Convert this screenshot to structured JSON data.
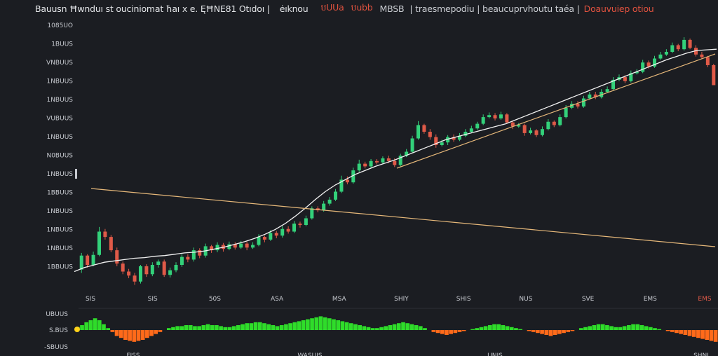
{
  "header": {
    "title": "Bauusn Ħwnduı st ouciniomat ħaı x e. ĘĦNE81 Otıdoı |",
    "segment_1": "ėıknou",
    "segment_2": "បUUa",
    "segment_3": "បubb",
    "segment_4": "MBSB",
    "segment_5": "| traesmepodiu | beaucuprvhoutu taéa |",
    "segment_6": "Doauvuiep otiou"
  },
  "price_axis": {
    "labels": [
      "1085UO",
      "1BUUS",
      "VNBUUS",
      "1NBUUS",
      "1NBUUS",
      "VUBUUS",
      "1NBUUS",
      "N0BUUS",
      "1NBUUS",
      "1BBUUS",
      "1NBUUS",
      "1NBUUS",
      "1NBUUS",
      "1BBUUS"
    ]
  },
  "time_axis": {
    "labels": [
      "SIS",
      "SIS",
      "50S",
      "ASA",
      "MSA",
      "SHIY",
      "SHIS",
      "NUS",
      "SVE",
      "EMS"
    ],
    "last_label": "EMS"
  },
  "oscillator": {
    "labels": [
      "UBUUS",
      "S.BUS",
      "-SBUUS"
    ],
    "bottom_labels": [
      "FISS",
      "WASUIS",
      "UNIS",
      "SHNI"
    ]
  },
  "colors": {
    "background": "#1b1d22",
    "up_candle": "#33d17a",
    "down_candle": "#e05a48",
    "moving_average": "#f2f2f2",
    "trendline": "#e6b87a",
    "histogram_positive": "#2fdc2a",
    "histogram_negative": "#ff6a1a",
    "highlight": "#ffd21a"
  },
  "chart_data": {
    "type": "candlestick",
    "series": [
      {
        "name": "",
        "values": [
          [
            0,
            367,
            346,
            372,
            342
          ],
          [
            1,
            346,
            360,
            364,
            344
          ],
          [
            2,
            360,
            345,
            362,
            340
          ],
          [
            3,
            345,
            310,
            347,
            303
          ],
          [
            4,
            310,
            318,
            322,
            306
          ],
          [
            5,
            318,
            338,
            341,
            315
          ],
          [
            6,
            338,
            358,
            362,
            334
          ],
          [
            7,
            358,
            370,
            374,
            355
          ],
          [
            8,
            370,
            376,
            380,
            366
          ],
          [
            9,
            376,
            385,
            390,
            372
          ],
          [
            10,
            385,
            362,
            388,
            360
          ],
          [
            11,
            362,
            374,
            378,
            359
          ],
          [
            12,
            374,
            360,
            377,
            356
          ],
          [
            13,
            360,
            355,
            364,
            352
          ],
          [
            14,
            355,
            375,
            378,
            352
          ],
          [
            15,
            375,
            368,
            379,
            364
          ],
          [
            16,
            368,
            360,
            371,
            356
          ],
          [
            17,
            360,
            348,
            363,
            344
          ],
          [
            18,
            348,
            352,
            356,
            344
          ],
          [
            19,
            352,
            338,
            355,
            334
          ],
          [
            20,
            338,
            346,
            350,
            335
          ],
          [
            21,
            346,
            332,
            349,
            328
          ],
          [
            22,
            332,
            338,
            342,
            330
          ],
          [
            23,
            338,
            330,
            341,
            326
          ],
          [
            24,
            330,
            336,
            340,
            327
          ],
          [
            25,
            336,
            329,
            338,
            325
          ],
          [
            26,
            329,
            334,
            337,
            326
          ],
          [
            27,
            334,
            328,
            336,
            324
          ],
          [
            28,
            328,
            334,
            338,
            325
          ],
          [
            29,
            334,
            330,
            336,
            326
          ],
          [
            30,
            330,
            318,
            332,
            314
          ],
          [
            31,
            318,
            322,
            326,
            316
          ],
          [
            32,
            322,
            312,
            324,
            308
          ],
          [
            33,
            312,
            316,
            320,
            309
          ],
          [
            34,
            316,
            306,
            319,
            302
          ],
          [
            35,
            306,
            310,
            313,
            302
          ],
          [
            36,
            310,
            298,
            312,
            294
          ],
          [
            37,
            298,
            300,
            304,
            295
          ],
          [
            38,
            300,
            290,
            302,
            286
          ],
          [
            39,
            290,
            275,
            292,
            272
          ],
          [
            40,
            275,
            278,
            281,
            272
          ],
          [
            41,
            278,
            268,
            280,
            264
          ],
          [
            42,
            268,
            262,
            271,
            258
          ],
          [
            43,
            262,
            250,
            264,
            246
          ],
          [
            44,
            250,
            232,
            252,
            226
          ],
          [
            45,
            232,
            236,
            239,
            227
          ],
          [
            46,
            236,
            218,
            238,
            214
          ],
          [
            47,
            218,
            208,
            220,
            202
          ],
          [
            48,
            208,
            212,
            215,
            205
          ],
          [
            49,
            212,
            204,
            214,
            201
          ],
          [
            50,
            204,
            206,
            209,
            201
          ],
          [
            51,
            206,
            200,
            208,
            197
          ],
          [
            52,
            200,
            204,
            207,
            196
          ],
          [
            53,
            204,
            210,
            213,
            200
          ],
          [
            54,
            210,
            196,
            212,
            193
          ],
          [
            55,
            196,
            190,
            198,
            186
          ],
          [
            56,
            190,
            170,
            192,
            166
          ],
          [
            57,
            170,
            150,
            172,
            144
          ],
          [
            58,
            150,
            160,
            163,
            148
          ],
          [
            59,
            160,
            168,
            172,
            156
          ],
          [
            60,
            168,
            180,
            184,
            164
          ],
          [
            61,
            180,
            176,
            182,
            172
          ],
          [
            62,
            176,
            168,
            180,
            165
          ],
          [
            63,
            168,
            172,
            175,
            164
          ],
          [
            64,
            172,
            166,
            174,
            162
          ],
          [
            65,
            166,
            160,
            168,
            156
          ],
          [
            66,
            160,
            155,
            162,
            151
          ],
          [
            67,
            155,
            148,
            157,
            145
          ],
          [
            68,
            148,
            138,
            150,
            134
          ],
          [
            69,
            138,
            135,
            140,
            131
          ],
          [
            70,
            135,
            140,
            143,
            132
          ],
          [
            71,
            140,
            134,
            142,
            130
          ],
          [
            72,
            134,
            146,
            148,
            132
          ],
          [
            73,
            146,
            152,
            156,
            143
          ],
          [
            74,
            152,
            150,
            154,
            147
          ],
          [
            75,
            150,
            162,
            166,
            148
          ],
          [
            76,
            162,
            158,
            164,
            154
          ],
          [
            77,
            158,
            165,
            168,
            156
          ],
          [
            78,
            165,
            156,
            167,
            152
          ],
          [
            79,
            156,
            145,
            158,
            141
          ],
          [
            80,
            145,
            150,
            153,
            143
          ],
          [
            81,
            150,
            138,
            152,
            134
          ],
          [
            82,
            138,
            124,
            140,
            120
          ],
          [
            83,
            124,
            118,
            126,
            114
          ],
          [
            84,
            118,
            122,
            125,
            114
          ],
          [
            85,
            122,
            110,
            124,
            106
          ],
          [
            86,
            110,
            104,
            112,
            100
          ],
          [
            87,
            104,
            108,
            111,
            100
          ],
          [
            88,
            108,
            100,
            110,
            96
          ],
          [
            89,
            100,
            96,
            102,
            92
          ],
          [
            90,
            96,
            82,
            98,
            78
          ],
          [
            91,
            82,
            78,
            84,
            74
          ],
          [
            92,
            78,
            84,
            87,
            75
          ],
          [
            93,
            84,
            72,
            86,
            68
          ],
          [
            94,
            72,
            70,
            74,
            66
          ],
          [
            95,
            70,
            56,
            72,
            52
          ],
          [
            96,
            56,
            62,
            65,
            53
          ],
          [
            97,
            62,
            50,
            64,
            46
          ],
          [
            98,
            50,
            44,
            52,
            40
          ],
          [
            99,
            44,
            40,
            46,
            36
          ],
          [
            100,
            40,
            30,
            42,
            26
          ],
          [
            101,
            30,
            36,
            39,
            28
          ],
          [
            102,
            36,
            22,
            38,
            18
          ],
          [
            103,
            22,
            34,
            36,
            20
          ],
          [
            104,
            34,
            44,
            47,
            30
          ],
          [
            105,
            44,
            48,
            50,
            40
          ],
          [
            106,
            48,
            60,
            63,
            46
          ],
          [
            107,
            60,
            90,
            62,
            58
          ]
        ]
      }
    ],
    "moving_average": [
      370,
      364,
      360,
      356,
      354,
      352,
      350,
      349,
      347,
      346,
      344,
      342,
      341,
      339,
      336,
      333,
      329,
      325,
      320,
      314,
      307,
      298,
      287,
      275,
      262,
      250,
      240,
      232,
      224,
      218,
      212,
      207,
      202,
      196,
      190,
      184,
      178,
      172,
      168,
      164,
      160,
      156,
      152,
      148,
      142,
      136,
      130,
      124,
      118,
      112,
      106,
      100,
      94,
      88,
      82,
      76,
      70,
      64,
      58,
      52,
      47,
      42,
      38,
      37,
      36
    ],
    "trendlines": [
      {
        "from": [
          24,
          0.52
        ],
        "to": [
          1020,
          0.69
        ]
      },
      {
        "from": [
          566,
          0.47
        ],
        "to": [
          1020,
          0.15
        ]
      }
    ],
    "oscillator": [
      3,
      5,
      8,
      10,
      12,
      10,
      6,
      2,
      -2,
      -6,
      -8,
      -10,
      -11,
      -12,
      -11,
      -10,
      -8,
      -6,
      -4,
      -2,
      0,
      2,
      3,
      4,
      4,
      5,
      5,
      4,
      4,
      5,
      6,
      5,
      5,
      4,
      3,
      3,
      4,
      5,
      6,
      7,
      7,
      8,
      8,
      7,
      6,
      5,
      4,
      5,
      6,
      7,
      8,
      9,
      10,
      11,
      12,
      13,
      14,
      13,
      12,
      11,
      10,
      9,
      8,
      7,
      6,
      5,
      4,
      3,
      2,
      2,
      3,
      4,
      5,
      6,
      7,
      8,
      7,
      6,
      5,
      4,
      2,
      0,
      -2,
      -3,
      -4,
      -5,
      -4,
      -3,
      -2,
      -1,
      0,
      1,
      2,
      3,
      4,
      5,
      6,
      6,
      5,
      4,
      3,
      2,
      1,
      0,
      -1,
      -2,
      -3,
      -4,
      -5,
      -6,
      -5,
      -4,
      -3,
      -2,
      -1,
      0,
      2,
      3,
      4,
      5,
      6,
      6,
      5,
      4,
      3,
      3,
      4,
      5,
      6,
      6,
      5,
      4,
      3,
      2,
      1,
      0,
      -1,
      -2,
      -3,
      -4,
      -5,
      -6,
      -7,
      -8,
      -9,
      -10,
      -11,
      -12
    ]
  }
}
